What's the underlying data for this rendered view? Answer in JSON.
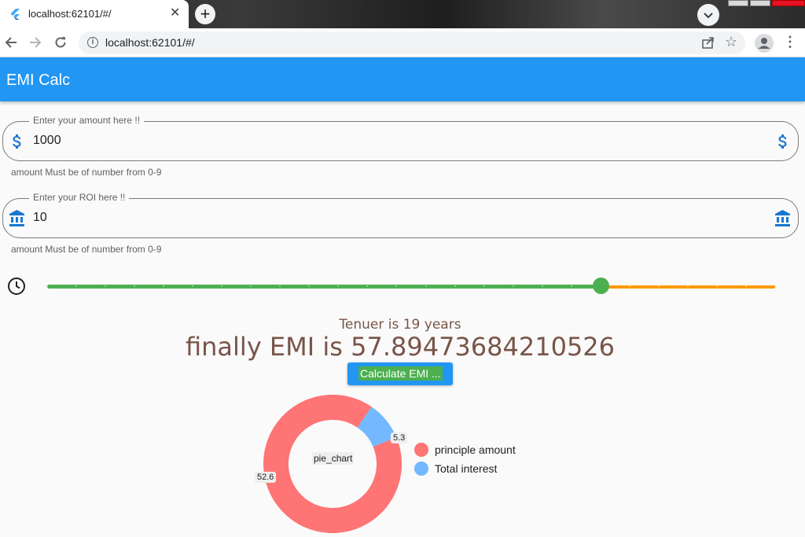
{
  "browser": {
    "tab_title": "localhost:62101/#/",
    "tab_close": "✕",
    "new_tab": "+",
    "url": "localhost:62101/#/",
    "info": "i",
    "star": "☆",
    "menu": "⋮"
  },
  "app": {
    "title": "EMI Calc",
    "amount_field": {
      "label": "Enter your amount here !!",
      "value": "1000",
      "helper": "amount Must be of number from 0-9"
    },
    "roi_field": {
      "label": "Enter your ROI here !!",
      "value": "10",
      "helper": "amount Must be of number from 0-9"
    },
    "tenure_slider": {
      "value": 19,
      "min": 0,
      "max": 25,
      "divisions": 25
    },
    "tenure_text": "Tenuer is 19 years",
    "emi_text": "finally EMI is 57.89473684210526",
    "calculate_label": "Calculate EMI ...",
    "pie": {
      "center_label": "pie_chart",
      "principle_value": 52.6,
      "interest_value": 5.3,
      "principle_label": "52.6",
      "interest_label": "5.3",
      "legend": [
        "principle amount",
        "Total interest"
      ]
    }
  },
  "colors": {
    "appbar": "#2196f3",
    "slider_active": "#4caf50",
    "slider_inactive": "#ff9800",
    "principle": "#ff7474",
    "interest": "#74b9ff",
    "text_brown": "#795548",
    "icon_blue": "#1976d2"
  }
}
